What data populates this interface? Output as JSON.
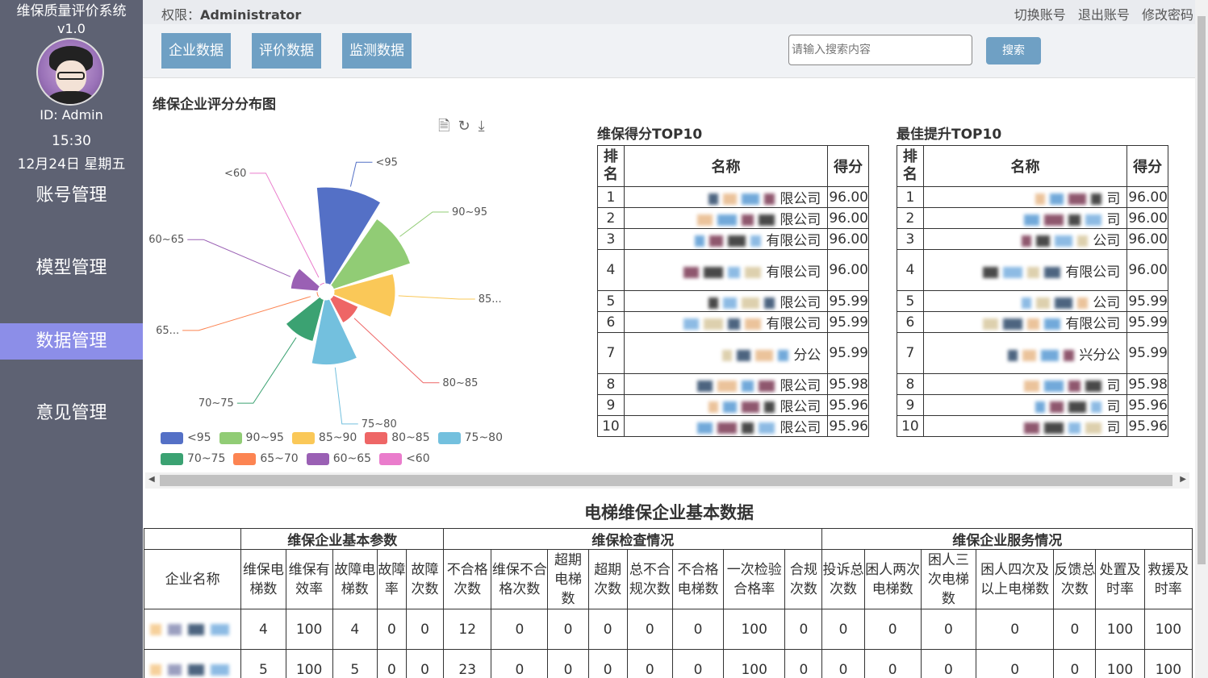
{
  "sidebar": {
    "title": "维保质量评价系统",
    "version": "v1.0",
    "user_id": "ID: Admin",
    "time": "15:30",
    "date": "12月24日 星期五",
    "menu": [
      {
        "label": "账号管理",
        "active": false
      },
      {
        "label": "模型管理",
        "active": false
      },
      {
        "label": "数据管理",
        "active": true
      },
      {
        "label": "意见管理",
        "active": false
      }
    ]
  },
  "topbar": {
    "perm_label": "权限：",
    "perm_value": "Administrator",
    "links": [
      "切换账号",
      "退出账号",
      "修改密码"
    ]
  },
  "actions": {
    "tabs": [
      "企业数据",
      "评价数据",
      "监测数据"
    ],
    "search_placeholder": "请输入搜索内容",
    "search_label": "搜索"
  },
  "chart_data": {
    "type": "pie",
    "variant": "rose",
    "title": "维保企业评分分布图",
    "categories": [
      "<95",
      "90~95",
      "85~90",
      "80~85",
      "75~80",
      "70~75",
      "65~70",
      "60~65",
      "<60"
    ],
    "callout_labels": [
      "<95",
      "90~95",
      "85...",
      "80~85",
      "75~80",
      "70~75",
      "65...",
      "60~65",
      "<60"
    ],
    "values": [
      100,
      70,
      40,
      8,
      45,
      20,
      0,
      8,
      0
    ],
    "colors": [
      "#5470c6",
      "#91cc75",
      "#fac858",
      "#ee6666",
      "#73c0de",
      "#3ba272",
      "#fc8452",
      "#9a60b4",
      "#ea7ccc"
    ],
    "legend_position": "bottom",
    "toolbox": [
      "data-view-icon",
      "restore-icon",
      "download-icon"
    ]
  },
  "rank_tables": [
    {
      "title": "维保得分TOP10",
      "headers": [
        "排名",
        "名称",
        "得分"
      ],
      "rows": [
        {
          "rank": "1",
          "name": "限公司",
          "score": "96.00"
        },
        {
          "rank": "2",
          "name": "限公司",
          "score": "96.00"
        },
        {
          "rank": "3",
          "name": "有限公司",
          "score": "96.00"
        },
        {
          "rank": "4",
          "name": "有限公司",
          "score": "96.00"
        },
        {
          "rank": "5",
          "name": "限公司",
          "score": "95.99"
        },
        {
          "rank": "6",
          "name": "有限公司",
          "score": "95.99"
        },
        {
          "rank": "7",
          "name": "分公",
          "score": "95.99"
        },
        {
          "rank": "8",
          "name": "限公司",
          "score": "95.98"
        },
        {
          "rank": "9",
          "name": "限公司",
          "score": "95.96"
        },
        {
          "rank": "10",
          "name": "限公司",
          "score": "95.96"
        }
      ]
    },
    {
      "title": "最佳提升TOP10",
      "headers": [
        "排名",
        "名称",
        "得分"
      ],
      "rows": [
        {
          "rank": "1",
          "name": "司",
          "score": "96.00"
        },
        {
          "rank": "2",
          "name": "司",
          "score": "96.00"
        },
        {
          "rank": "3",
          "name": "公司",
          "score": "96.00"
        },
        {
          "rank": "4",
          "name": "有限公司",
          "score": "96.00"
        },
        {
          "rank": "5",
          "name": "公司",
          "score": "95.99"
        },
        {
          "rank": "6",
          "name": "有限公司",
          "score": "95.99"
        },
        {
          "rank": "7",
          "name": "兴分公",
          "score": "95.99"
        },
        {
          "rank": "8",
          "name": "司",
          "score": "95.98"
        },
        {
          "rank": "9",
          "name": "司",
          "score": "95.96"
        },
        {
          "rank": "10",
          "name": "司",
          "score": "95.96"
        }
      ]
    }
  ],
  "basic": {
    "title": "电梯维保企业基本数据",
    "groups": [
      "维保企业基本参数",
      "维保检查情况",
      "维保企业服务情况"
    ],
    "headers": [
      "企业名称",
      "维保电梯数",
      "维保有效率",
      "故障电梯数",
      "故障率",
      "故障次数",
      "不合格次数",
      "维保不合格次数",
      "超期电梯数",
      "超期次数",
      "总不合规次数",
      "不合格电梯数",
      "一次检验合格率",
      "合规次数",
      "投诉总次数",
      "困人两次电梯数",
      "困人三次电梯数",
      "困人四次及以上电梯数",
      "反馈总次数",
      "处置及时率",
      "救援及时率"
    ],
    "rows": [
      [
        "",
        "4",
        "100",
        "4",
        "0",
        "0",
        "12",
        "0",
        "0",
        "0",
        "0",
        "0",
        "100",
        "0",
        "0",
        "0",
        "0",
        "0",
        "0",
        "100",
        "100"
      ],
      [
        "",
        "5",
        "100",
        "5",
        "0",
        "0",
        "23",
        "0",
        "0",
        "0",
        "0",
        "0",
        "100",
        "0",
        "0",
        "0",
        "0",
        "0",
        "0",
        "100",
        "100"
      ]
    ]
  }
}
